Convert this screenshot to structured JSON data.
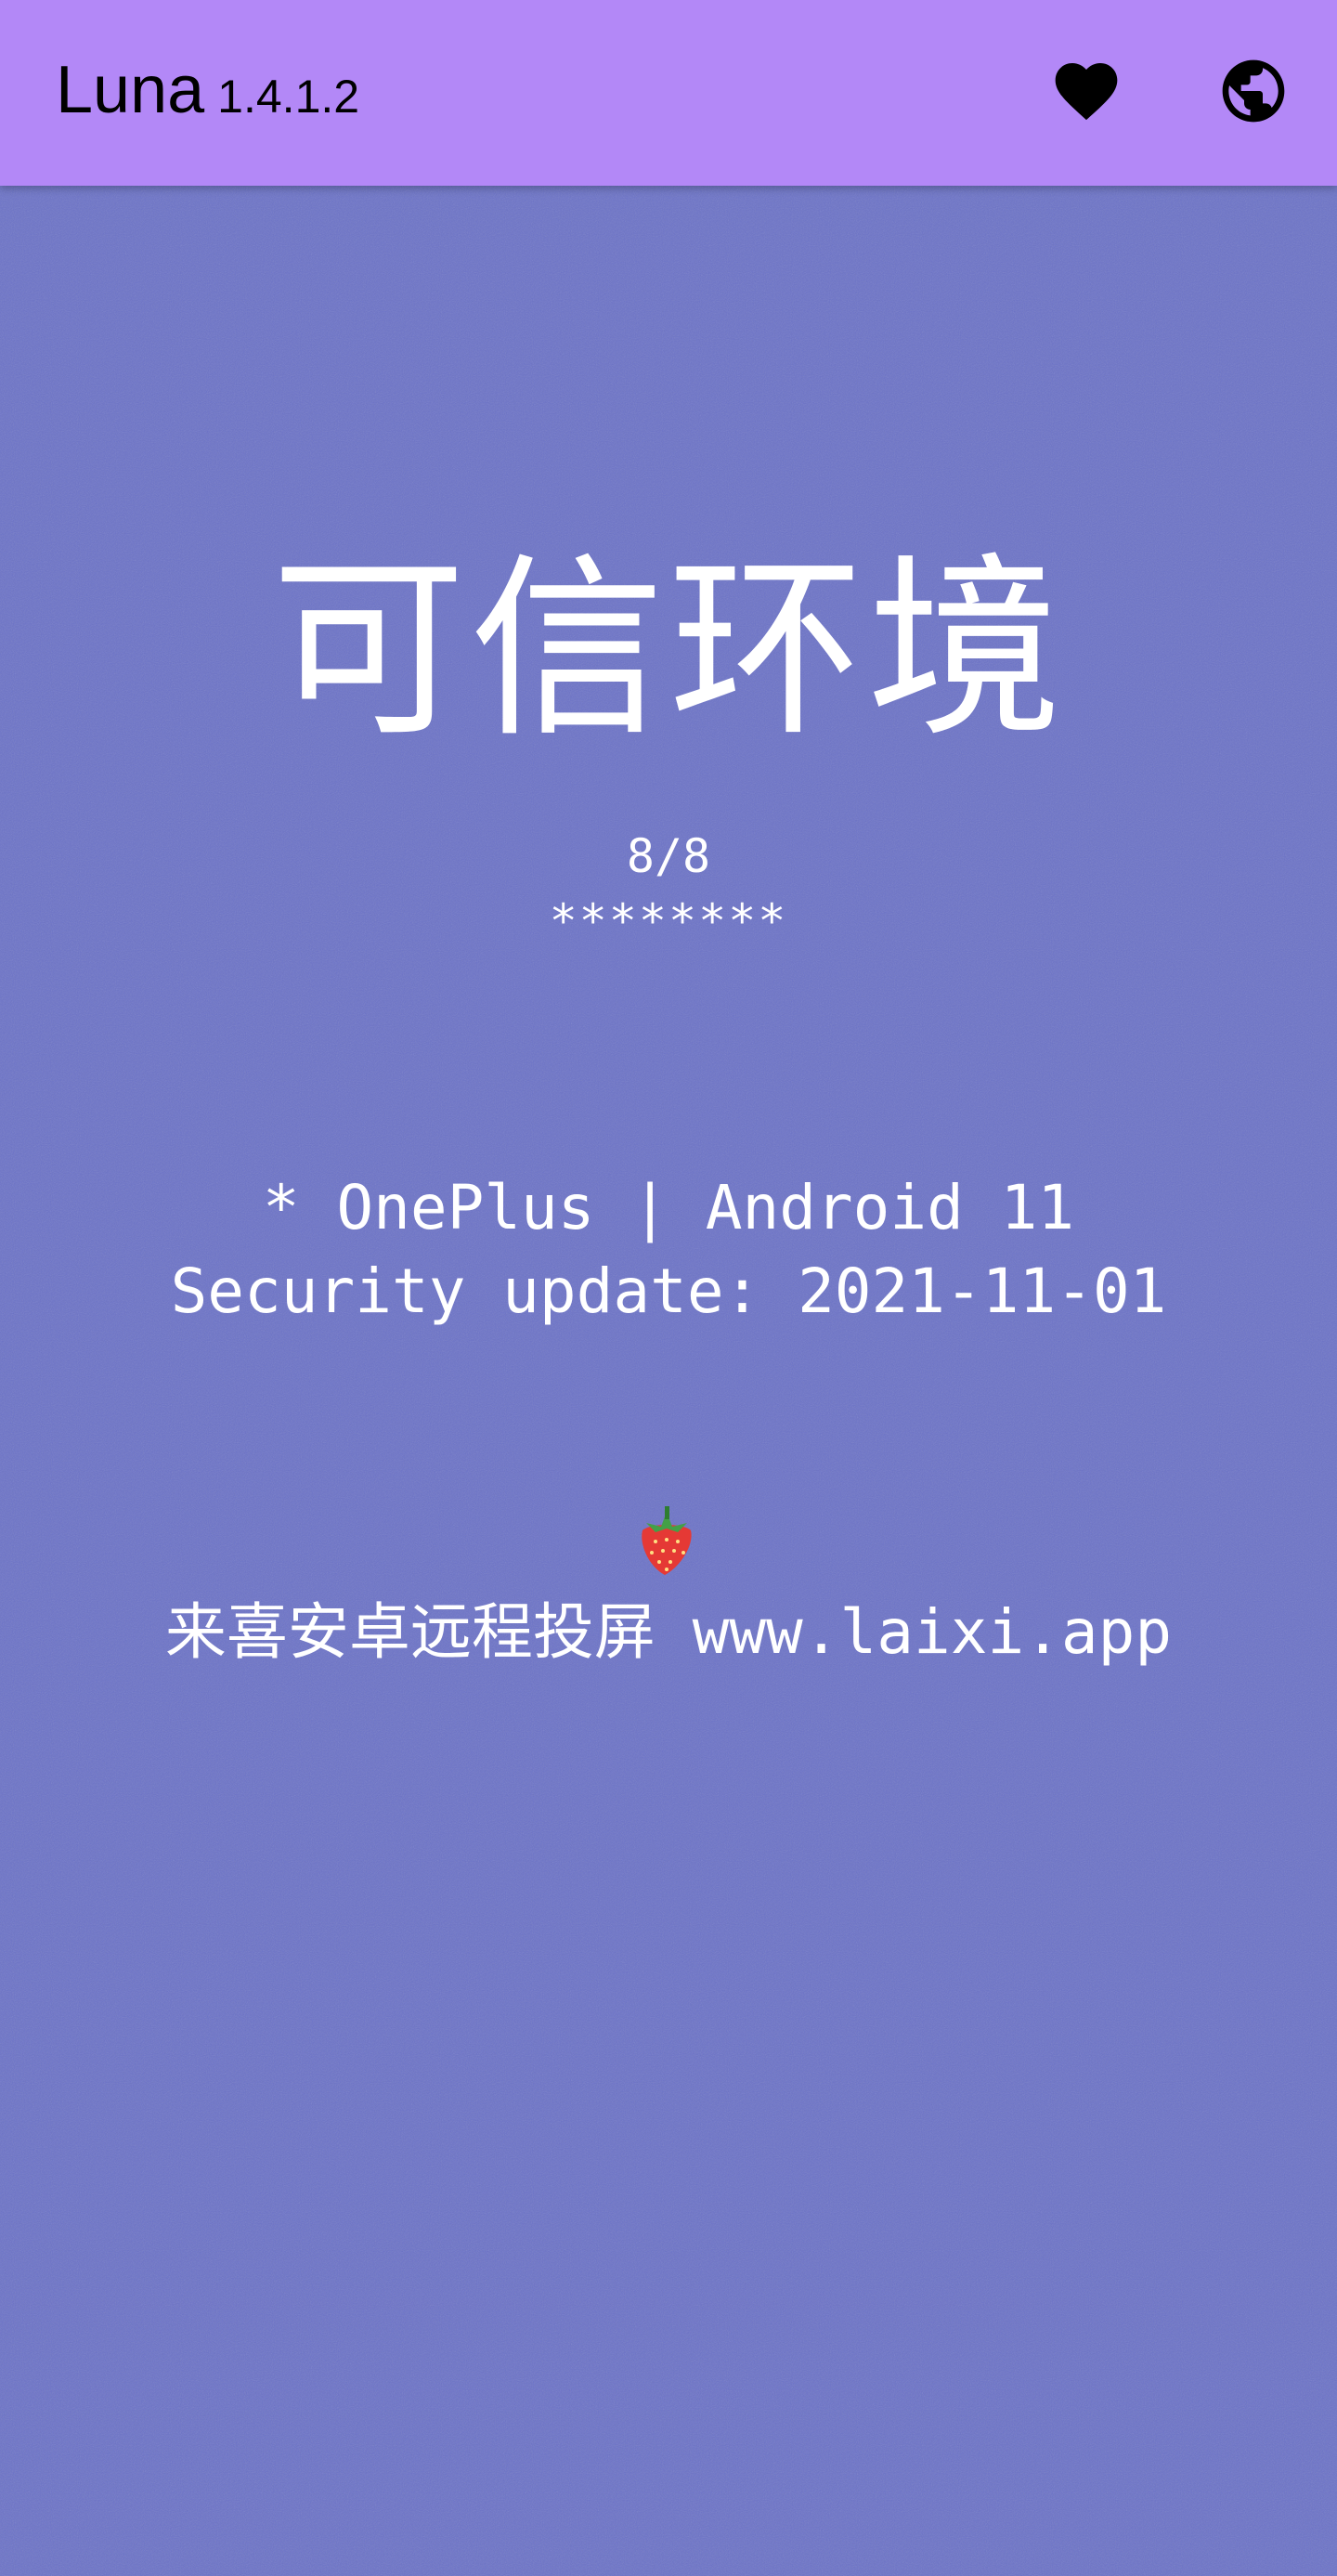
{
  "appbar": {
    "app_name": "Luna",
    "version": "1.4.1.2",
    "background_color": "#b388f7",
    "actions": [
      {
        "icon": "heart-icon"
      },
      {
        "icon": "globe-icon"
      }
    ]
  },
  "main": {
    "background_color": "#6b72c8",
    "status_title": "可信环境",
    "check_count": "8/8",
    "check_stars": "********",
    "device_line": "* OnePlus | Android 11",
    "security_line": "Security update: 2021-11-01",
    "promo_icon": "strawberry-icon",
    "promo_text": "来喜安卓远程投屏 www.laixi.app"
  }
}
